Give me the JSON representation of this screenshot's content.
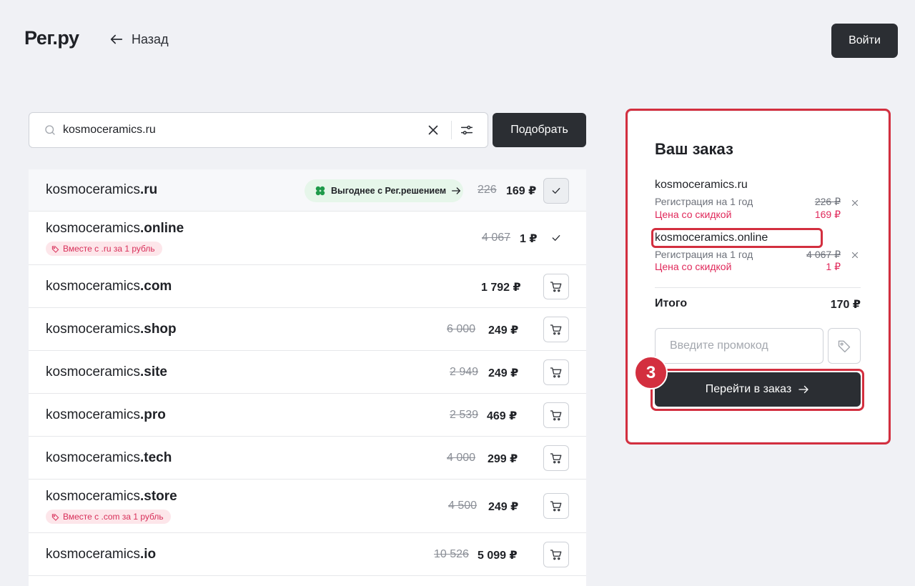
{
  "header": {
    "logo": "Рег.ру",
    "back_label": "Назад",
    "login_label": "Войти"
  },
  "search": {
    "value": "kosmoceramics.ru",
    "submit_label": "Подобрать"
  },
  "domains": [
    {
      "base": "kosmoceramics",
      "tld": ".ru",
      "old_price": "226",
      "price": "169 ₽",
      "state": "selected",
      "promo": "Выгоднее с Рег.решением"
    },
    {
      "base": "kosmoceramics",
      "tld": ".online",
      "old_price": "4 067",
      "price": "1 ₽",
      "state": "added",
      "badge": "Вместе с .ru за 1 рубль"
    },
    {
      "base": "kosmoceramics",
      "tld": ".com",
      "old_price": "",
      "price": "1 792 ₽",
      "state": "cart"
    },
    {
      "base": "kosmoceramics",
      "tld": ".shop",
      "old_price": "6 000",
      "price": "249 ₽",
      "state": "cart"
    },
    {
      "base": "kosmoceramics",
      "tld": ".site",
      "old_price": "2 949",
      "price": "249 ₽",
      "state": "cart"
    },
    {
      "base": "kosmoceramics",
      "tld": ".pro",
      "old_price": "2 539",
      "price": "469 ₽",
      "state": "cart"
    },
    {
      "base": "kosmoceramics",
      "tld": ".tech",
      "old_price": "4 000",
      "price": "299 ₽",
      "state": "cart"
    },
    {
      "base": "kosmoceramics",
      "tld": ".store",
      "old_price": "4 500",
      "price": "249 ₽",
      "state": "cart",
      "badge": "Вместе с .com за 1 рубль"
    },
    {
      "base": "kosmoceramics",
      "tld": ".io",
      "old_price": "10 526",
      "price": "5 099 ₽",
      "state": "cart"
    }
  ],
  "order": {
    "title": "Ваш заказ",
    "items": [
      {
        "name": "kosmoceramics.ru",
        "reg_label": "Регистрация на 1 год",
        "discount_label": "Цена со скидкой",
        "old_price": "226 ₽",
        "price": "169 ₽"
      },
      {
        "name": "kosmoceramics.online",
        "reg_label": "Регистрация на 1 год",
        "discount_label": "Цена со скидкой",
        "old_price": "4 067 ₽",
        "price": "1 ₽"
      }
    ],
    "total_label": "Итого",
    "total_value": "170 ₽",
    "promo_placeholder": "Введите промокод",
    "checkout_label": "Перейти в заказ",
    "step_number": "3"
  },
  "colors": {
    "accent_dark": "#2b2e33",
    "highlight_red": "#d32f3f",
    "discount_pink": "#e0285a",
    "promo_green": "#e6f6ea"
  }
}
